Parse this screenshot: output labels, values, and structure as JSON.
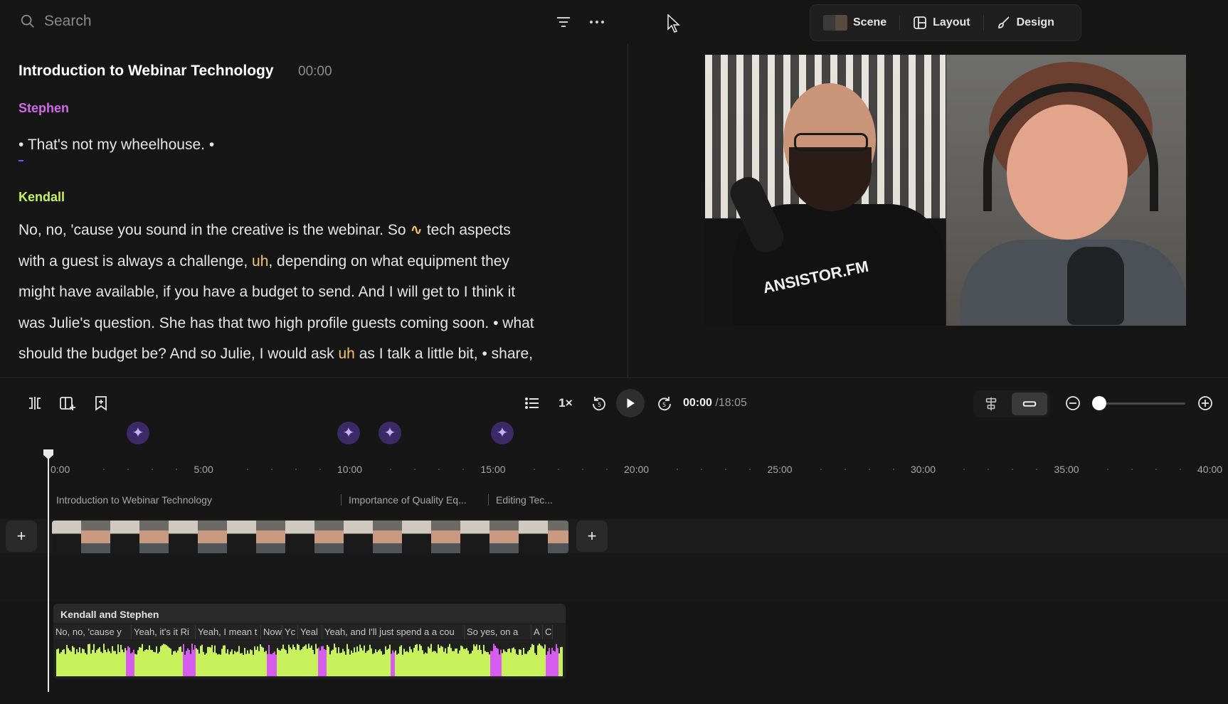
{
  "search": {
    "placeholder": "Search"
  },
  "view_tabs": [
    {
      "label": "Scene"
    },
    {
      "label": "Layout"
    },
    {
      "label": "Design"
    }
  ],
  "section": {
    "title": "Introduction to Webinar Technology",
    "time": "00:00"
  },
  "speakers": {
    "first": "Stephen",
    "second": "Kendall"
  },
  "transcript": {
    "stephen_line": "That's not my wheelhouse.",
    "kendall": {
      "p1a": "No, no, 'cause you sound in the creative is the webinar. So",
      "p1b": "tech aspects",
      "p2a": "with a guest is always a challenge,",
      "filler1": "uh",
      "p2b": ", depending on what equipment they",
      "p3": "might have available, if you have a budget to send. And I will get to I think it",
      "p4a": "was Julie's question. She has that two high profile guests coming soon.",
      "p4b": "what",
      "p5a": "should the budget be? And so Julie, I would ask",
      "filler2": "uh",
      "p5b": "as I talk a little bit,",
      "p5c": "share,"
    }
  },
  "player": {
    "speed": "1×",
    "current_time": "00:00",
    "total_time": "/18:05",
    "zoom_level": 0.05
  },
  "timeline": {
    "ruler": [
      "0:00",
      "5:00",
      "10:00",
      "15:00",
      "20:00",
      "25:00",
      "30:00",
      "35:00",
      "40:00"
    ],
    "chapters": [
      "Introduction to Webinar Technology",
      "Importance of Quality Eq...",
      "Editing Tec..."
    ],
    "audio_track": {
      "title": "Kendall and Stephen",
      "captions": [
        "No, no, 'cause y",
        "Yeah, it's it Ri",
        "Yeah, I mean t",
        "Now I",
        "Yc",
        "Yeal",
        "Yeah, and I'll just spend a a cou",
        "So yes, on a",
        "A",
        "C"
      ]
    }
  },
  "colors": {
    "stephen": "#d06ae8",
    "kendall": "#c8f25c",
    "filler": "#f3c36a",
    "waveform_main": "#c8f25c",
    "waveform_alt": "#d65cf0"
  }
}
